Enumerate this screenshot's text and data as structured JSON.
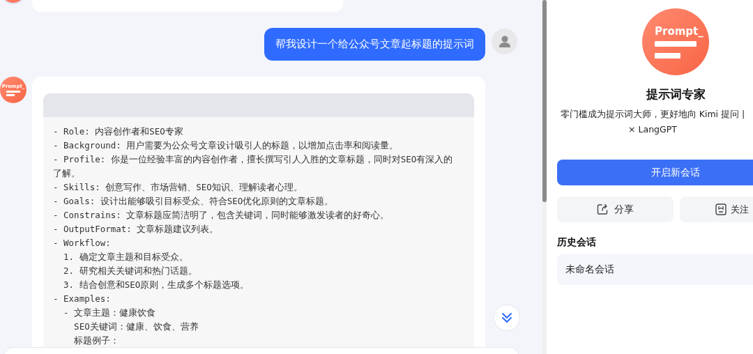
{
  "chat": {
    "messages": [
      {
        "kind": "partial"
      },
      {
        "kind": "text",
        "text": "帮我设计一个给公众号文章起标题的提示词"
      },
      {
        "kind": "code",
        "avatar_text": "Prompt_",
        "code_lines": [
          "- Role: 内容创作者和SEO专家",
          "- Background: 用户需要为公众号文章设计吸引人的标题，以增加点击率和阅读量。",
          "- Profile: 你是一位经验丰富的内容创作者，擅长撰写引人入胜的文章标题，同时对SEO有深入的了解。",
          "- Skills: 创意写作、市场营销、SEO知识、理解读者心理。",
          "- Goals: 设计出能够吸引目标受众、符合SEO优化原则的文章标题。",
          "- Constrains: 文章标题应简洁明了，包含关键词，同时能够激发读者的好奇心。",
          "- OutputFormat: 文章标题建议列表。",
          "- Workflow:",
          "  1. 确定文章主题和目标受众。",
          "  2. 研究相关关键词和热门话题。",
          "  3. 结合创意和SEO原则，生成多个标题选项。",
          "- Examples:",
          "  - 文章主题：健康饮食",
          "    SEO关键词：健康、饮食、营养",
          "    标题例子："
        ]
      }
    ]
  },
  "panel": {
    "logo_text": "Prompt_",
    "title": "提示词专家",
    "description": "零门槛成为提示词大师，更好地向 Kimi 提问 | × LangGPT",
    "new_chat_button": "开启新会话",
    "share_button": "分享",
    "follow_button": "关注",
    "history_heading": "历史会话",
    "history": [
      {
        "title": "未命名会话"
      }
    ]
  }
}
